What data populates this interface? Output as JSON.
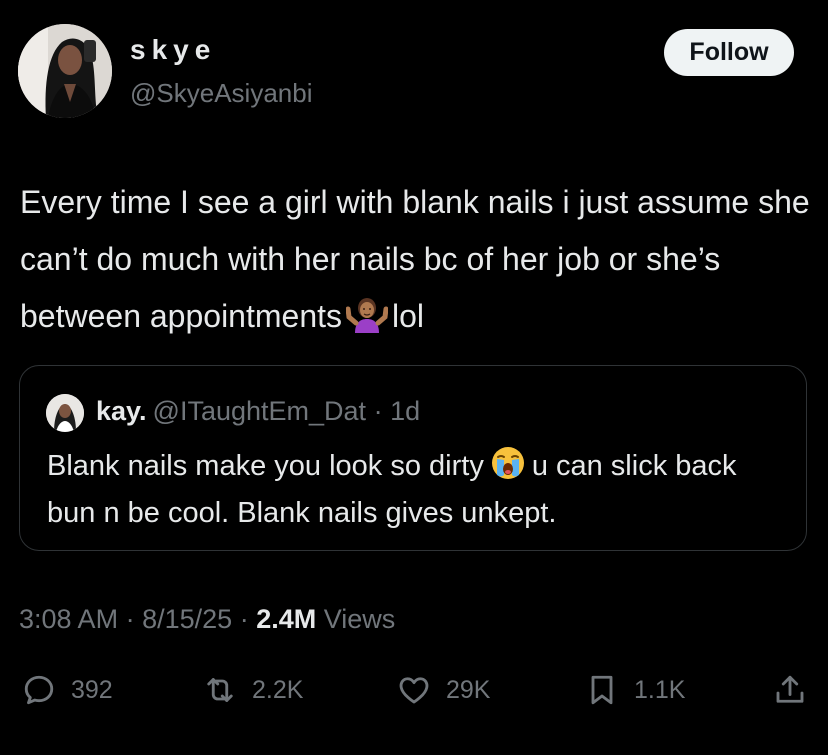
{
  "tweet": {
    "author": {
      "display_name": "skye",
      "handle": "@SkyeAsiyanbi"
    },
    "follow_label": "Follow",
    "text_parts": [
      "Every time I see a girl with blank nails i just assume she can’t do much with her nails bc of her job or she’s between appointments",
      "lol"
    ],
    "emoji": "person-shrugging-emoji",
    "quote": {
      "name": "kay.",
      "handle": "@ITaughtEm_Dat",
      "separator": "·",
      "age": "1d",
      "text_parts": [
        "Blank nails make you look so dirty",
        "u can slick back bun n be cool. Blank nails gives unkept."
      ],
      "emoji": "loudly-crying-face-emoji"
    },
    "time": "3:08 AM",
    "date": "8/15/25",
    "dot": "·",
    "views_count": "2.4M",
    "views_label": "Views",
    "actions": {
      "replies": "392",
      "reposts": "2.2K",
      "likes": "29K",
      "bookmarks": "1.1K"
    }
  },
  "colors": {
    "background": "#000000",
    "text": "#e7e9ea",
    "secondary_text": "#71767b",
    "border": "#2f3336",
    "follow_bg": "#eff3f4"
  }
}
